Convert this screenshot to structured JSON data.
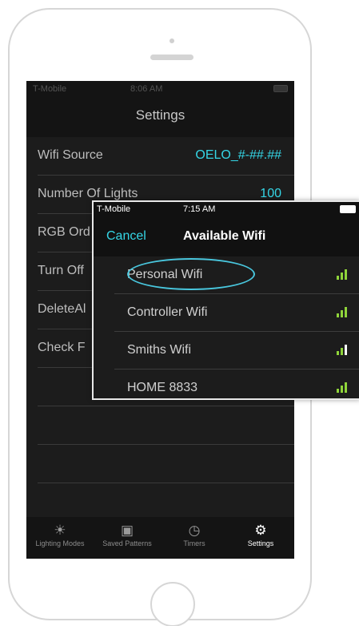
{
  "status_bar": {
    "carrier": "T-Mobile",
    "time": "8:06 AM"
  },
  "nav": {
    "title": "Settings"
  },
  "settings": [
    {
      "label": "Wifi Source",
      "value": "OELO_#-##.##"
    },
    {
      "label": "Number Of Lights",
      "value": "100"
    },
    {
      "label": "RGB Ord",
      "value": ""
    },
    {
      "label": "Turn Off",
      "value": ""
    },
    {
      "label": "DeleteAl",
      "value": ""
    },
    {
      "label": "Check F",
      "value": ""
    }
  ],
  "tabs": [
    {
      "label": "Lighting Modes",
      "icon": "sun-icon"
    },
    {
      "label": "Saved Patterns",
      "icon": "save-icon"
    },
    {
      "label": "Timers",
      "icon": "alarm-icon"
    },
    {
      "label": "Settings",
      "icon": "gear-icon"
    }
  ],
  "popup": {
    "status": {
      "carrier": "T-Mobile",
      "time": "7:15 AM"
    },
    "cancel": "Cancel",
    "title": "Available Wifi",
    "networks": [
      {
        "name": "Personal Wifi",
        "selected": true
      },
      {
        "name": "Controller Wifi",
        "selected": false
      },
      {
        "name": "Smiths Wifi",
        "selected": false
      },
      {
        "name": "HOME 8833",
        "selected": false
      }
    ]
  },
  "colors": {
    "accent": "#35d6e6",
    "signal": "#8fd43a",
    "background": "#1c1c1c"
  }
}
